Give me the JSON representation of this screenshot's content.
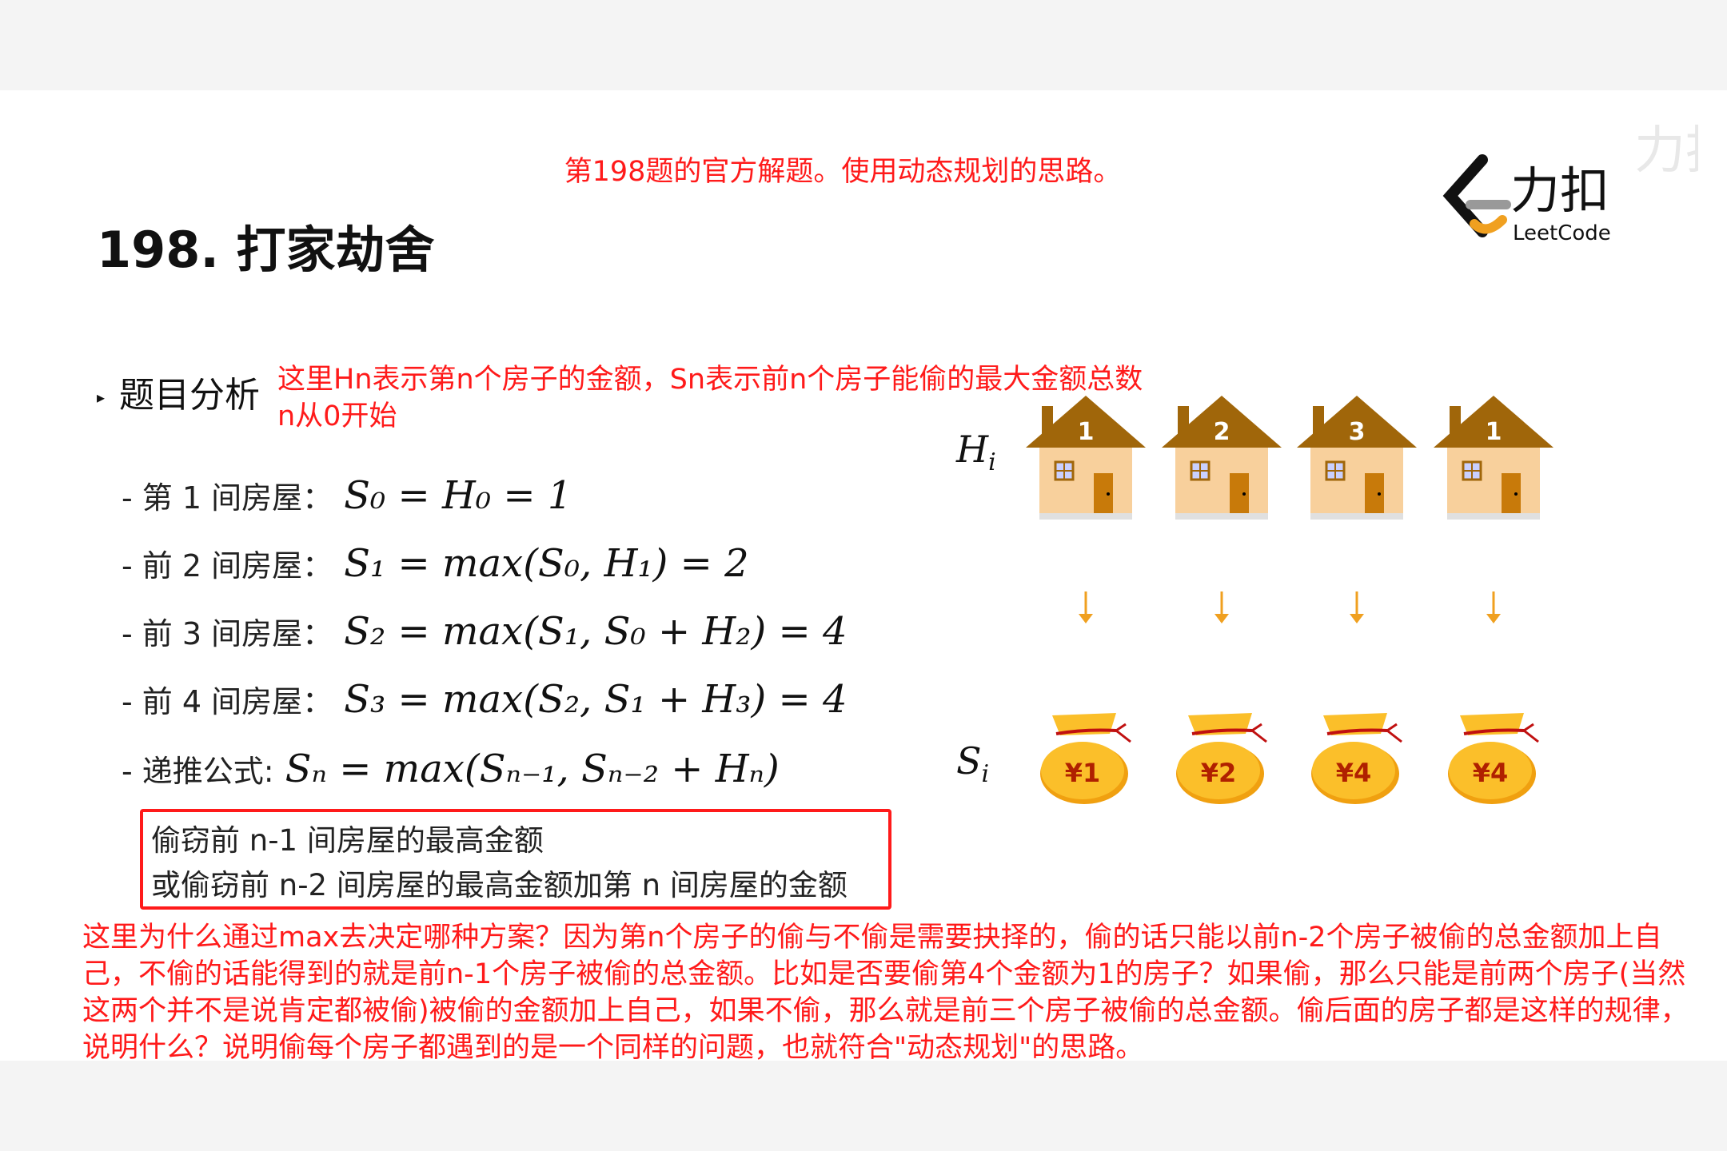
{
  "caption": "第198题的官方解题。使用动态规划的思路。",
  "title": "198. 打家劫舍",
  "logo": {
    "cn": "力扣",
    "en": "LeetCode",
    "watermark": "力扣"
  },
  "section": "题目分析",
  "note": [
    "这里Hn表示第n个房子的金额，Sn表示前n个房子能偷的最大金额总数",
    "n从0开始"
  ],
  "items": [
    {
      "label": "- 第 1 间房屋：",
      "formula": "S₀ = H₀ = 1"
    },
    {
      "label": "- 前 2 间房屋：",
      "formula": "S₁ = max(S₀, H₁) = 2"
    },
    {
      "label": "- 前 3 间房屋：",
      "formula": "S₂ = max(S₁, S₀ + H₂) = 4"
    },
    {
      "label": "- 前 4 间房屋：",
      "formula": "S₃ = max(S₂, S₁ + H₃) = 4"
    },
    {
      "label": "- 递推公式:",
      "formula": "Sₙ = max(Sₙ₋₁, Sₙ₋₂ + Hₙ)"
    }
  ],
  "box": [
    "偷窃前 n-1 间房屋的最高金额",
    "或偷窃前 n-2 间房屋的最高金额加第 n 间房屋的金额"
  ],
  "explanation": "这里为什么通过max去决定哪种方案？因为第n个房子的偷与不偷是需要抉择的，偷的话只能以前n-2个房子被偷的总金额加上自己，不偷的话能得到的就是前n-1个房子被偷的总金额。比如是否要偷第4个金额为1的房子？如果偷，那么只能是前两个房子(当然这两个并不是说肯定都被偷)被偷的金额加上自己，如果不偷，那么就是前三个房子被偷的总金额。偷后面的房子都是这样的规律，说明什么？说明偷每个房子都遇到的是一个同样的问题，也就符合\"动态规划\"的思路。",
  "diagram": {
    "h_label": "H",
    "h_sub": "i",
    "s_label": "S",
    "s_sub": "i",
    "houses": [
      "1",
      "2",
      "3",
      "1"
    ],
    "bags": [
      "¥1",
      "¥2",
      "¥4",
      "¥4"
    ]
  },
  "colors": {
    "accent": "#ff1a1a",
    "roof": "#a0660a",
    "wall": "#f8d09c",
    "bag": "#fbbf2a",
    "arrow": "#f0a020"
  }
}
